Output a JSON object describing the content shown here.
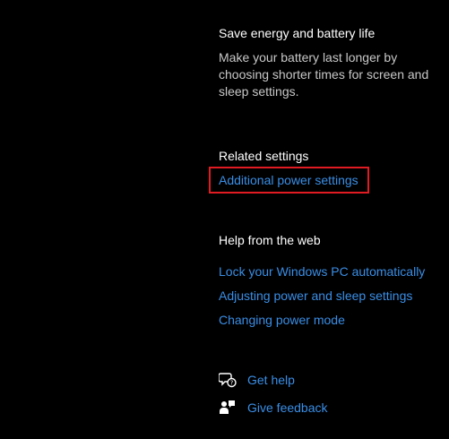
{
  "power_saving": {
    "title": "Save energy and battery life",
    "description": "Make your battery last longer by choosing shorter times for screen and sleep settings."
  },
  "related_settings": {
    "title": "Related settings",
    "links": [
      {
        "label": "Additional power settings"
      }
    ],
    "highlight_color": "#e11b22"
  },
  "help_from_web": {
    "title": "Help from the web",
    "links": [
      {
        "label": "Lock your Windows PC automatically"
      },
      {
        "label": "Adjusting power and sleep settings"
      },
      {
        "label": "Changing power mode"
      }
    ]
  },
  "support": {
    "get_help": {
      "label": "Get help",
      "icon": "get-help-icon"
    },
    "give_feedback": {
      "label": "Give feedback",
      "icon": "feedback-icon"
    }
  },
  "colors": {
    "background": "#000000",
    "text": "#ffffff",
    "secondary_text": "#c8c8c8",
    "link": "#3a8ee6"
  }
}
